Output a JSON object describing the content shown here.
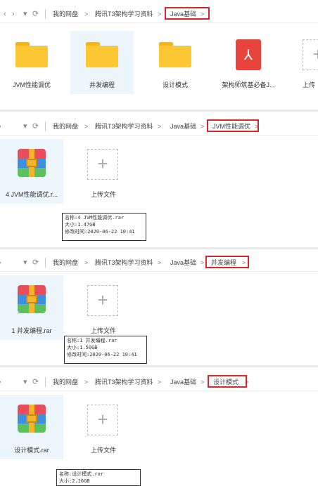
{
  "nav": {
    "back": "‹",
    "forward": "›",
    "dropdown": "▾",
    "refresh": "⟳",
    "separator": ">"
  },
  "breadcrumb": {
    "root": "我的网盘",
    "course": "腾讯T3架构学习资料",
    "java": "Java基础",
    "jvm": "JVM性能调优",
    "concurrency": "并发编程",
    "patterns": "设计模式"
  },
  "panel1": {
    "items": [
      {
        "label": "JVM性能调优",
        "icon": "folder-icon"
      },
      {
        "label": "并发编程",
        "icon": "folder-icon"
      },
      {
        "label": "设计模式",
        "icon": "folder-icon"
      },
      {
        "label": "架构师筑基必备J...",
        "icon": "pdf-icon"
      },
      {
        "label": "上传",
        "icon": "upload-icon"
      }
    ]
  },
  "panel2": {
    "file_label": "4 JVM性能调优.r...",
    "upload_label": "上传文件",
    "tooltip": {
      "name": "名称:4 JVM性能调优.rar",
      "size": "大小:1.47GB",
      "modified": "修改时间:2020-06-22 10:41"
    }
  },
  "panel3": {
    "file_label": "1 并发编程.rar",
    "upload_label": "上传文件",
    "tooltip": {
      "name": "名称:1 并发编程.rar",
      "size": "大小:1.50GB",
      "modified": "修改时间:2020-06-22 10:41"
    }
  },
  "panel4": {
    "file_label": "设计模式.rar",
    "upload_label": "上传文件",
    "tooltip": {
      "name": "名称:设计模式.rar",
      "size": "大小:2.16GB"
    }
  },
  "colors": {
    "highlight": "#d9262c",
    "folder": "#fbc834",
    "pdf": "#e8423c",
    "selected_bg": "#eef6fd"
  }
}
